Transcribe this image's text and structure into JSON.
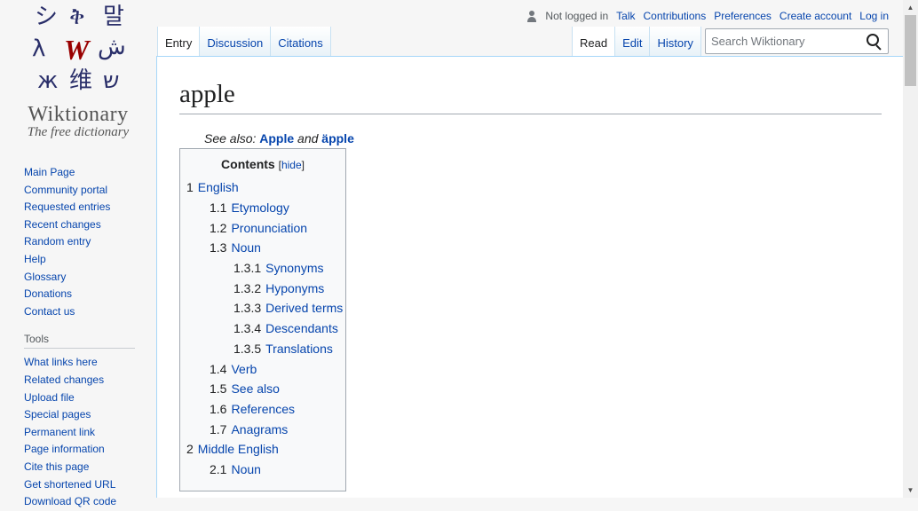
{
  "logo": {
    "glyphs": [
      "シ",
      "ቅ",
      "말",
      "λ",
      "W",
      "ش",
      "ж",
      "维",
      "ש"
    ],
    "wordmark": "Wiktionary",
    "tagline": "The free dictionary"
  },
  "sidebar": {
    "nav": [
      "Main Page",
      "Community portal",
      "Requested entries",
      "Recent changes",
      "Random entry",
      "Help",
      "Glossary",
      "Donations",
      "Contact us"
    ],
    "tools_heading": "Tools",
    "tools": [
      "What links here",
      "Related changes",
      "Upload file",
      "Special pages",
      "Permanent link",
      "Page information",
      "Cite this page",
      "Get shortened URL",
      "Download QR code"
    ]
  },
  "personal": {
    "anon": "Not logged in",
    "links": [
      "Talk",
      "Contributions",
      "Preferences",
      "Create account",
      "Log in"
    ]
  },
  "tabs": {
    "left": [
      "Entry",
      "Discussion",
      "Citations"
    ],
    "right": [
      "Read",
      "Edit",
      "History"
    ]
  },
  "search": {
    "placeholder": "Search Wiktionary"
  },
  "page": {
    "title": "apple",
    "see_also_prefix": "See also:",
    "see_also_1": "Apple",
    "see_also_and": "and",
    "see_also_2": "äpple"
  },
  "toc": {
    "title": "Contents",
    "hide_open": "[",
    "hide": "hide",
    "hide_close": "]",
    "items": [
      {
        "num": "1",
        "label": "English",
        "level": 1
      },
      {
        "num": "1.1",
        "label": "Etymology",
        "level": 2
      },
      {
        "num": "1.2",
        "label": "Pronunciation",
        "level": 2
      },
      {
        "num": "1.3",
        "label": "Noun",
        "level": 2
      },
      {
        "num": "1.3.1",
        "label": "Synonyms",
        "level": 3
      },
      {
        "num": "1.3.2",
        "label": "Hyponyms",
        "level": 3
      },
      {
        "num": "1.3.3",
        "label": "Derived terms",
        "level": 3
      },
      {
        "num": "1.3.4",
        "label": "Descendants",
        "level": 3
      },
      {
        "num": "1.3.5",
        "label": "Translations",
        "level": 3
      },
      {
        "num": "1.4",
        "label": "Verb",
        "level": 2
      },
      {
        "num": "1.5",
        "label": "See also",
        "level": 2
      },
      {
        "num": "1.6",
        "label": "References",
        "level": 2
      },
      {
        "num": "1.7",
        "label": "Anagrams",
        "level": 2
      },
      {
        "num": "2",
        "label": "Middle English",
        "level": 1
      },
      {
        "num": "2.1",
        "label": "Noun",
        "level": 2
      }
    ]
  },
  "colors": {
    "link": "#0645ad",
    "text": "#202122",
    "logo_red": "#990000"
  },
  "scrollbar": {
    "up": "▲",
    "down": "▼"
  }
}
